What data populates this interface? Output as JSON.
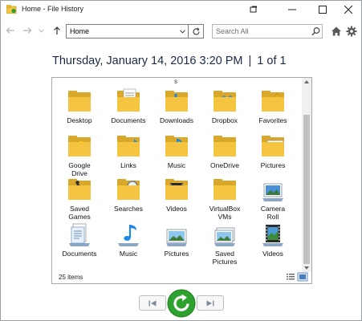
{
  "window": {
    "title": "Home - File History"
  },
  "nav": {
    "address": "Home",
    "search_placeholder": "Search All"
  },
  "header": {
    "date": "Thursday, January 14, 2016 3:20 PM",
    "separator": "|",
    "page": "1 of 1"
  },
  "pane": {
    "top_label": "s",
    "status": "25 items",
    "items": [
      {
        "label": "Desktop",
        "icon": "folder-desktop"
      },
      {
        "label": "Documents",
        "icon": "folder-documents"
      },
      {
        "label": "Downloads",
        "icon": "folder-downloads"
      },
      {
        "label": "Dropbox",
        "icon": "folder-dropbox"
      },
      {
        "label": "Favorites",
        "icon": "folder-favorites"
      },
      {
        "label": "Google\nDrive",
        "icon": "folder-google-drive"
      },
      {
        "label": "Links",
        "icon": "folder-links"
      },
      {
        "label": "Music",
        "icon": "folder-music"
      },
      {
        "label": "OneDrive",
        "icon": "folder-onedrive"
      },
      {
        "label": "Pictures",
        "icon": "folder-pictures"
      },
      {
        "label": "Saved\nGames",
        "icon": "folder-saved-games"
      },
      {
        "label": "Searches",
        "icon": "folder-searches"
      },
      {
        "label": "Videos",
        "icon": "folder-videos"
      },
      {
        "label": "VirtualBox\nVMs",
        "icon": "folder-plain"
      },
      {
        "label": "Camera\nRoll",
        "icon": "library-camera-roll"
      },
      {
        "label": "Documents",
        "icon": "library-documents"
      },
      {
        "label": "Music",
        "icon": "library-music"
      },
      {
        "label": "Pictures",
        "icon": "library-pictures"
      },
      {
        "label": "Saved\nPictures",
        "icon": "library-saved-pictures"
      },
      {
        "label": "Videos",
        "icon": "library-videos"
      }
    ]
  },
  "colors": {
    "folder": "#f5c542",
    "folder_dark": "#d9a72a",
    "accent_green": "#2fa12f",
    "date_text": "#1b2a44"
  }
}
